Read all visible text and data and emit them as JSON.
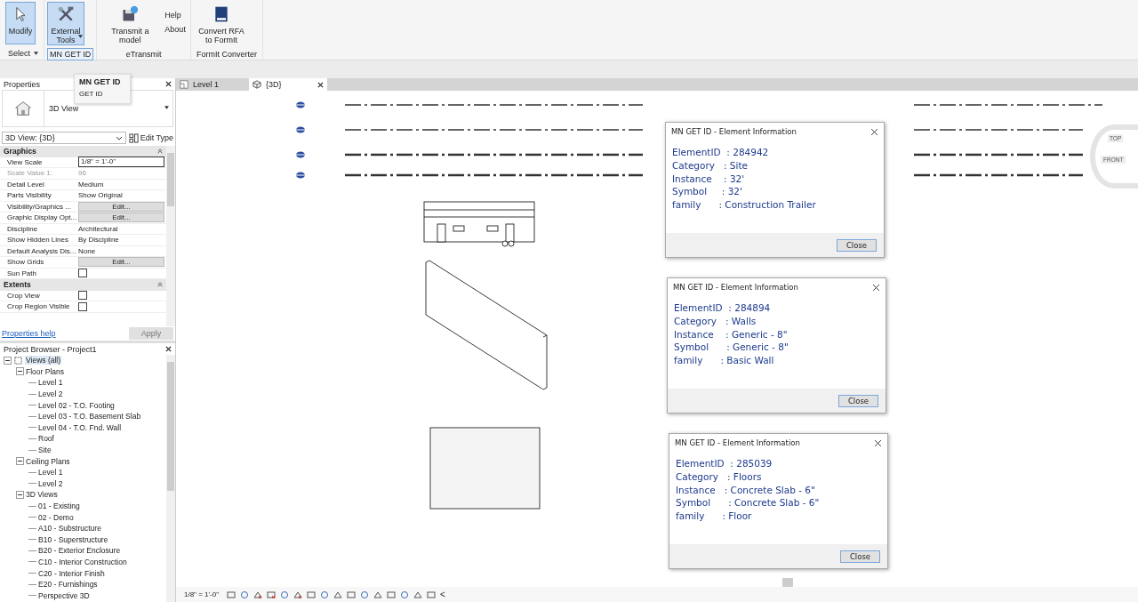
{
  "ribbon": {
    "groups": [
      {
        "panel": "Select",
        "panel_dropdown": true,
        "panel_boxed": false,
        "buttons": [
          {
            "label": "Modify",
            "kind": "large",
            "selected": true,
            "dropdown": false
          }
        ]
      },
      {
        "panel": "MN GET ID",
        "panel_dropdown": false,
        "panel_boxed": true,
        "buttons": [
          {
            "label": "External Tools",
            "kind": "large",
            "selected": true,
            "dropdown": true
          }
        ]
      },
      {
        "panel": "eTransmit",
        "panel_dropdown": false,
        "panel_boxed": false,
        "buttons": [
          {
            "label": "Transmit a model",
            "kind": "large",
            "selected": false,
            "dropdown": false
          },
          {
            "label": "Help",
            "kind": "small",
            "selected": false
          },
          {
            "label": "About",
            "kind": "small",
            "selected": false
          }
        ]
      },
      {
        "panel": "FormIt Converter",
        "panel_dropdown": false,
        "panel_boxed": false,
        "buttons": [
          {
            "label": "Convert RFA to FormIt",
            "kind": "large",
            "selected": false,
            "dropdown": false
          }
        ]
      }
    ]
  },
  "tooltip": {
    "title": "MN GET ID",
    "text": "GET ID"
  },
  "properties": {
    "title": "Properties",
    "type_name": "3D View",
    "selector": "3D View: {3D}",
    "edit_type": "Edit Type",
    "sections": [
      {
        "title": "Graphics",
        "rows": [
          {
            "label": "View Scale",
            "value": "1/8\" = 1'-0\"",
            "kind": "input",
            "disabled": false
          },
          {
            "label": "Scale Value    1:",
            "value": "96",
            "kind": "text",
            "disabled": true
          },
          {
            "label": "Detail Level",
            "value": "Medium",
            "kind": "text",
            "disabled": false
          },
          {
            "label": "Parts Visibility",
            "value": "Show Original",
            "kind": "text",
            "disabled": false
          },
          {
            "label": "Visibility/Graphics ...",
            "value": "Edit...",
            "kind": "button",
            "disabled": false
          },
          {
            "label": "Graphic Display Opt...",
            "value": "Edit...",
            "kind": "button",
            "disabled": false
          },
          {
            "label": "Discipline",
            "value": "Architectural",
            "kind": "text",
            "disabled": false
          },
          {
            "label": "Show Hidden Lines",
            "value": "By Discipline",
            "kind": "text",
            "disabled": false
          },
          {
            "label": "Default Analysis Dis...",
            "value": "None",
            "kind": "text",
            "disabled": false
          },
          {
            "label": "Show Grids",
            "value": "Edit...",
            "kind": "button",
            "disabled": false
          },
          {
            "label": "Sun Path",
            "checked": false,
            "kind": "checkbox",
            "disabled": false
          }
        ]
      },
      {
        "title": "Extents",
        "rows": [
          {
            "label": "Crop View",
            "checked": false,
            "kind": "checkbox",
            "disabled": false
          },
          {
            "label": "Crop Region Visible",
            "checked": false,
            "kind": "checkbox",
            "disabled": false
          }
        ]
      }
    ],
    "help_link": "Properties help",
    "apply": {
      "label": "Apply",
      "disabled": true
    }
  },
  "project_browser": {
    "title": "Project Browser - Project1",
    "tree": [
      {
        "label": "Views (all)",
        "selected": true,
        "expanded": true,
        "children": [
          {
            "label": "Floor Plans",
            "selected": false,
            "expanded": true,
            "children": [
              {
                "label": "Level 1",
                "selected": false
              },
              {
                "label": "Level 2",
                "selected": false
              },
              {
                "label": "Level 02 - T.O. Footing",
                "selected": false
              },
              {
                "label": "Level 03 - T.O. Basement Slab",
                "selected": false
              },
              {
                "label": "Level 04 - T.O. Fnd. Wall",
                "selected": false
              },
              {
                "label": "Roof",
                "selected": false
              },
              {
                "label": "Site",
                "selected": false
              }
            ]
          },
          {
            "label": "Ceiling Plans",
            "selected": false,
            "expanded": true,
            "children": [
              {
                "label": "Level 1",
                "selected": false
              },
              {
                "label": "Level 2",
                "selected": false
              }
            ]
          },
          {
            "label": "3D Views",
            "selected": false,
            "expanded": true,
            "children": [
              {
                "label": "01 - Existing",
                "selected": false
              },
              {
                "label": "02 - Demo",
                "selected": false
              },
              {
                "label": "A10 - Substructure",
                "selected": false
              },
              {
                "label": "B10 - Superstructure",
                "selected": false
              },
              {
                "label": "B20 - Exterior Enclosure",
                "selected": false
              },
              {
                "label": "C10 - Interior Construction",
                "selected": false
              },
              {
                "label": "C20 - Interior Finish",
                "selected": false
              },
              {
                "label": "E20 - Furnishings",
                "selected": false
              },
              {
                "label": "Perspective 3D",
                "selected": false
              }
            ]
          }
        ]
      }
    ]
  },
  "view_tabs": [
    {
      "label": "Level 1",
      "selected": false
    },
    {
      "label": "{3D}",
      "selected": true
    }
  ],
  "view_cube": {
    "top": "TOP",
    "front": "FRONT"
  },
  "dialogs": [
    {
      "title": "MN GET ID  - Element Information",
      "lines": [
        "ElementID  : 284942",
        "Category   : Site",
        "Instance    : 32'",
        "Symbol     : 32'",
        "family      : Construction Trailer"
      ],
      "button": "Close"
    },
    {
      "title": "MN GET ID  - Element Information",
      "lines": [
        "ElementID  : 284894",
        "Category   : Walls",
        "Instance    : Generic - 8\"",
        "Symbol      : Generic - 8\"",
        "family      : Basic Wall"
      ],
      "button": "Close"
    },
    {
      "title": "MN GET ID  - Element Information",
      "lines": [
        "ElementID  : 285039",
        "Category   : Floors",
        "Instance   : Concrete Slab - 6\"",
        "Symbol      : Concrete Slab - 6\"",
        "family      : Floor"
      ],
      "button": "Close"
    }
  ],
  "status_bar": {
    "scale": "1/8\" = 1'-0\"",
    "collapse": "<"
  }
}
